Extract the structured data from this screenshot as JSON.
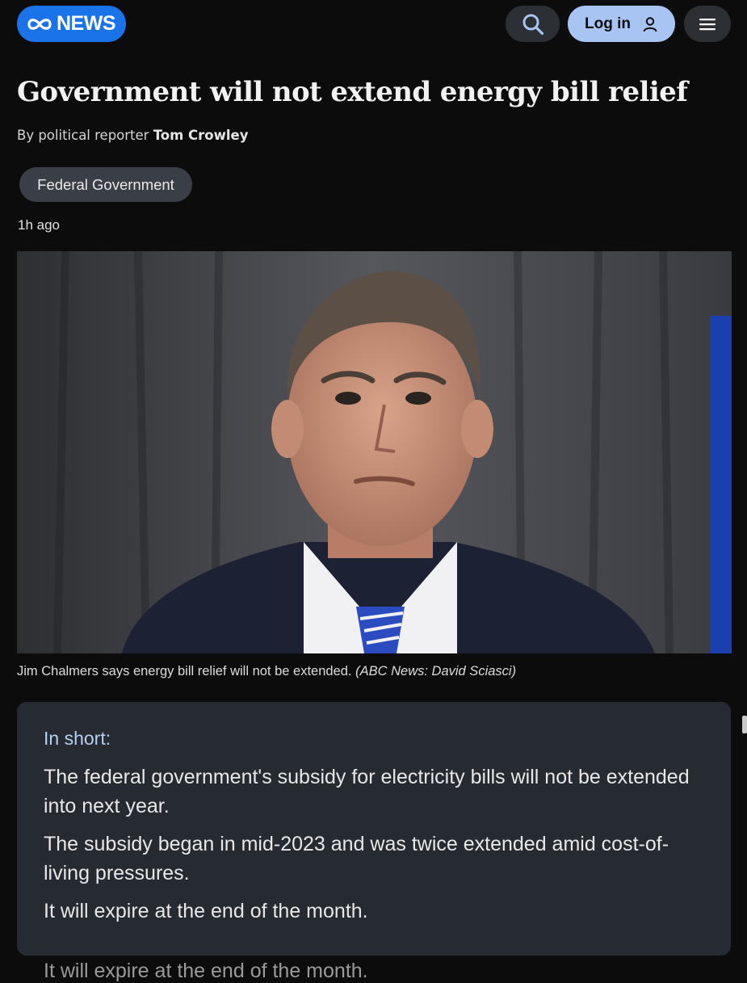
{
  "header": {
    "logo_text": "NEWS",
    "search_icon": "search-icon",
    "login_label": "Log in",
    "login_icon": "user-icon",
    "menu_icon": "hamburger-menu-icon",
    "brand_color": "#1a73e8",
    "login_color": "#a7c4f2"
  },
  "article": {
    "headline": "Government will not extend energy bill relief",
    "byline_prefix": "By political reporter",
    "author": "Tom Crowley",
    "tag": "Federal Government",
    "timestamp": "1h ago",
    "caption_text": "Jim Chalmers says energy bill relief will not be extended.",
    "caption_credit": "(ABC News: David Sciasci)"
  },
  "summary": {
    "title": "In short:",
    "points": [
      "The federal government's subsidy for electricity bills will not be extended into next year.",
      "The subsidy began in mid-2023 and was twice extended amid cost-of-living pressures.",
      "It will expire at the end of the month."
    ],
    "title_color": "#b7cff3"
  },
  "below_fold_text": "It will expire at the end of the month."
}
